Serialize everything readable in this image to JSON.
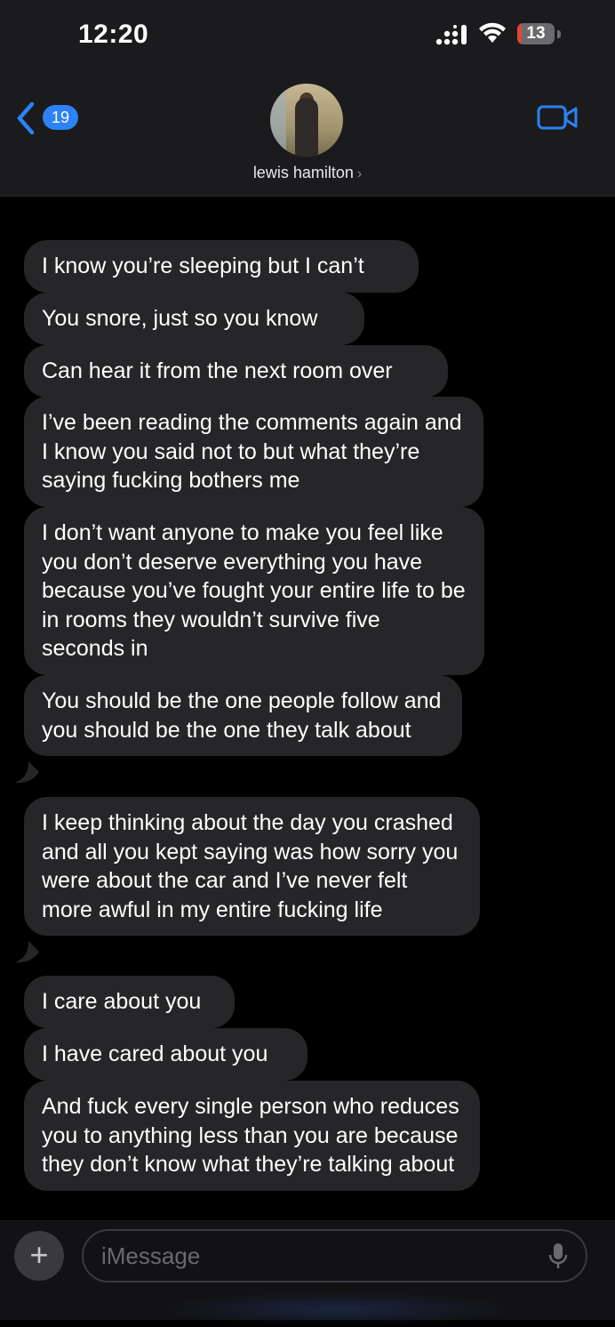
{
  "status_bar": {
    "time": "12:20",
    "battery_level": "13",
    "icons": [
      "cellular-signal-icon",
      "wifi-icon",
      "battery-icon"
    ]
  },
  "header": {
    "back_badge_count": "19",
    "contact_name": "lewis hamilton",
    "chevron": "›",
    "icons": [
      "back-chevron-icon",
      "video-call-icon",
      "avatar-photo"
    ]
  },
  "messages": [
    {
      "text": "I know you’re sleeping but I can’t"
    },
    {
      "text": "You snore, just so you know"
    },
    {
      "text": "Can hear it from the next room over"
    },
    {
      "text": "I’ve been reading the comments again and I know you said not to but what they’re saying fucking bothers me"
    },
    {
      "text": "I don’t want anyone to make you feel like you don’t deserve everything you have because you’ve fought your entire life to be in rooms they wouldn’t survive five seconds in"
    },
    {
      "text": "You should be the one people follow and you should be the one they talk about"
    },
    {
      "text": "I keep thinking about the day you crashed and all you kept saying was how sorry you were about the car and I’ve never felt more awful in my entire fucking life"
    },
    {
      "text": "I care about you"
    },
    {
      "text": "I have cared about you"
    },
    {
      "text": "And fuck every single person who reduces you to anything less than you are because they don’t know what they’re talking about"
    }
  ],
  "input_bar": {
    "plus_label": "+",
    "placeholder": "iMessage",
    "icons": [
      "plus-icon",
      "microphone-icon"
    ]
  },
  "colors": {
    "background": "#000000",
    "header_bg": "#1b1b1d",
    "incoming_bubble": "#262629",
    "accent_blue": "#2c82f6",
    "battery_low": "#e0453a"
  }
}
